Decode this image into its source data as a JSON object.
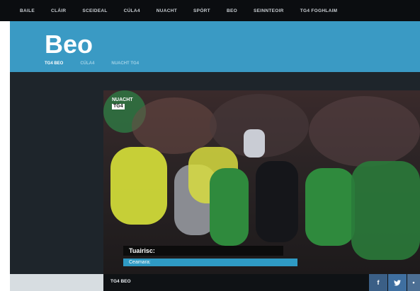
{
  "topnav": {
    "items": [
      "BAILE",
      "CLÁIR",
      "SCEIDEAL",
      "CÚLA4",
      "NUACHT",
      "SPÓRT",
      "BEO",
      "SEINNTEOIR",
      "TG4 FOGHLAIM"
    ]
  },
  "hero": {
    "title": "Beo",
    "tabs": [
      "TG4 BEO",
      "CÚLA4",
      "NUACHT TG4"
    ],
    "active_tab": "TG4 BEO"
  },
  "player": {
    "channel_bug": {
      "line1": "NUACHT",
      "line2": "TG4"
    },
    "lower_third": {
      "reporter_label": "Tuairisc:",
      "camera_label": "Ceamara:"
    },
    "bar_label": "TG4 BEO",
    "social": {
      "facebook": "f",
      "twitter": "twitter-icon",
      "more": "more-icon"
    }
  },
  "colors": {
    "nav_bg": "#0b0d10",
    "hero_bg": "#3a9ac4",
    "site_bg": "#1e252b",
    "accent_blue": "#2f9ac4"
  }
}
